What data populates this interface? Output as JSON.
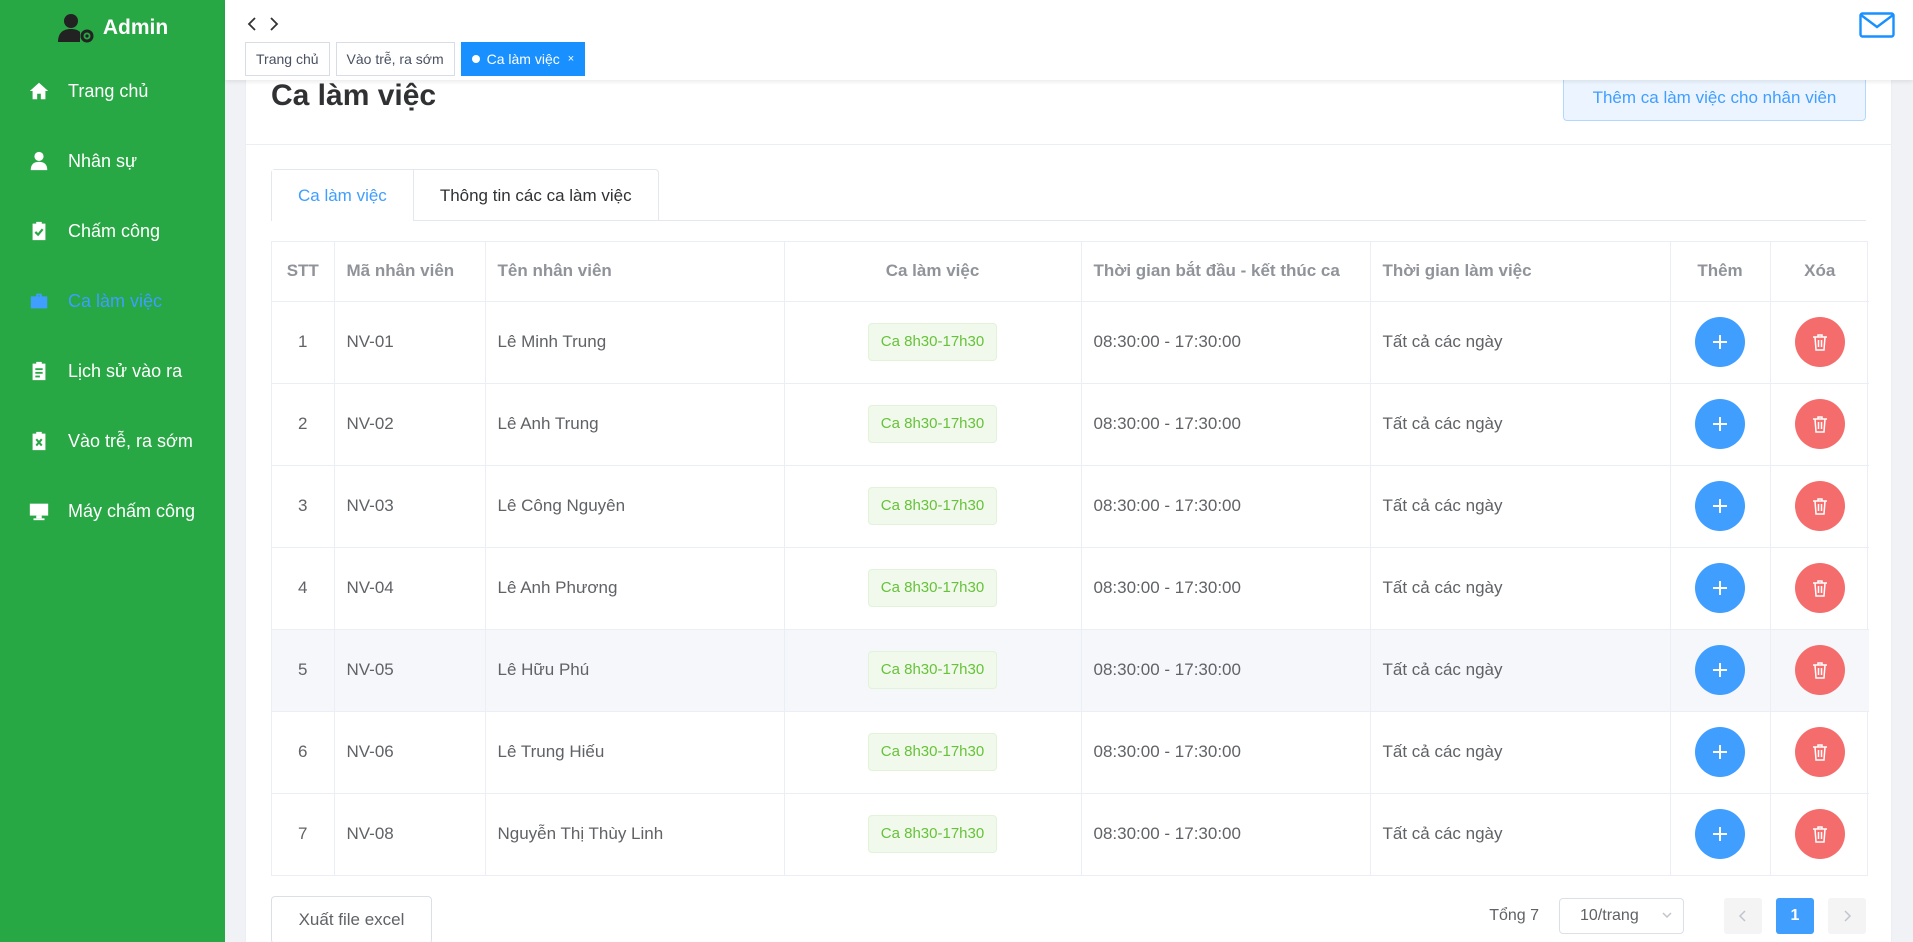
{
  "sidebar": {
    "brand": "Admin",
    "items": [
      {
        "label": "Trang chủ",
        "icon": "home-icon"
      },
      {
        "label": "Nhân sự",
        "icon": "user-icon"
      },
      {
        "label": "Chấm công",
        "icon": "clipboard-check-icon"
      },
      {
        "label": "Ca làm việc",
        "icon": "briefcase-icon",
        "active": true
      },
      {
        "label": "Lịch sử vào ra",
        "icon": "clipboard-list-icon"
      },
      {
        "label": "Vào trễ, ra sớm",
        "icon": "clipboard-x-icon"
      },
      {
        "label": "Máy chấm công",
        "icon": "monitor-icon"
      }
    ]
  },
  "topbar": {
    "tags": [
      {
        "label": "Trang chủ"
      },
      {
        "label": "Vào trễ, ra sớm"
      },
      {
        "label": "Ca làm việc",
        "active": true,
        "close": "×"
      }
    ]
  },
  "main": {
    "title": "Ca làm việc",
    "add_button": "Thêm ca làm việc cho nhân viên",
    "tabs": [
      {
        "label": "Ca làm việc",
        "active": true
      },
      {
        "label": "Thông tin các ca làm việc"
      }
    ],
    "table": {
      "headers": [
        "STT",
        "Mã nhân viên",
        "Tên nhân viên",
        "Ca làm việc",
        "Thời gian bắt đầu - kết thúc ca",
        "Thời gian làm việc",
        "Thêm",
        "Xóa"
      ],
      "rows": [
        {
          "stt": "1",
          "code": "NV-01",
          "name": "Lê Minh Trung",
          "shift": "Ca 8h30-17h30",
          "time": "08:30:00 - 17:30:00",
          "days": "Tất cả các ngày"
        },
        {
          "stt": "2",
          "code": "NV-02",
          "name": "Lê Anh Trung",
          "shift": "Ca 8h30-17h30",
          "time": "08:30:00 - 17:30:00",
          "days": "Tất cả các ngày"
        },
        {
          "stt": "3",
          "code": "NV-03",
          "name": "Lê Công Nguyên",
          "shift": "Ca 8h30-17h30",
          "time": "08:30:00 - 17:30:00",
          "days": "Tất cả các ngày"
        },
        {
          "stt": "4",
          "code": "NV-04",
          "name": "Lê Anh Phương",
          "shift": "Ca 8h30-17h30",
          "time": "08:30:00 - 17:30:00",
          "days": "Tất cả các ngày"
        },
        {
          "stt": "5",
          "code": "NV-05",
          "name": "Lê Hữu Phú",
          "shift": "Ca 8h30-17h30",
          "time": "08:30:00 - 17:30:00",
          "days": "Tất cả các ngày"
        },
        {
          "stt": "6",
          "code": "NV-06",
          "name": "Lê Trung Hiếu",
          "shift": "Ca 8h30-17h30",
          "time": "08:30:00 - 17:30:00",
          "days": "Tất cả các ngày"
        },
        {
          "stt": "7",
          "code": "NV-08",
          "name": "Nguyễn Thị Thùy Linh",
          "shift": "Ca 8h30-17h30",
          "time": "08:30:00 - 17:30:00",
          "days": "Tất cả các ngày"
        }
      ]
    },
    "export_button": "Xuất file excel",
    "pagination": {
      "total": "Tổng 7",
      "page_size": "10/trang",
      "current_page": "1"
    }
  },
  "colors": {
    "sidebar_bg": "#28a745",
    "primary": "#409eff",
    "danger": "#f56c6c",
    "success": "#67c23a"
  }
}
